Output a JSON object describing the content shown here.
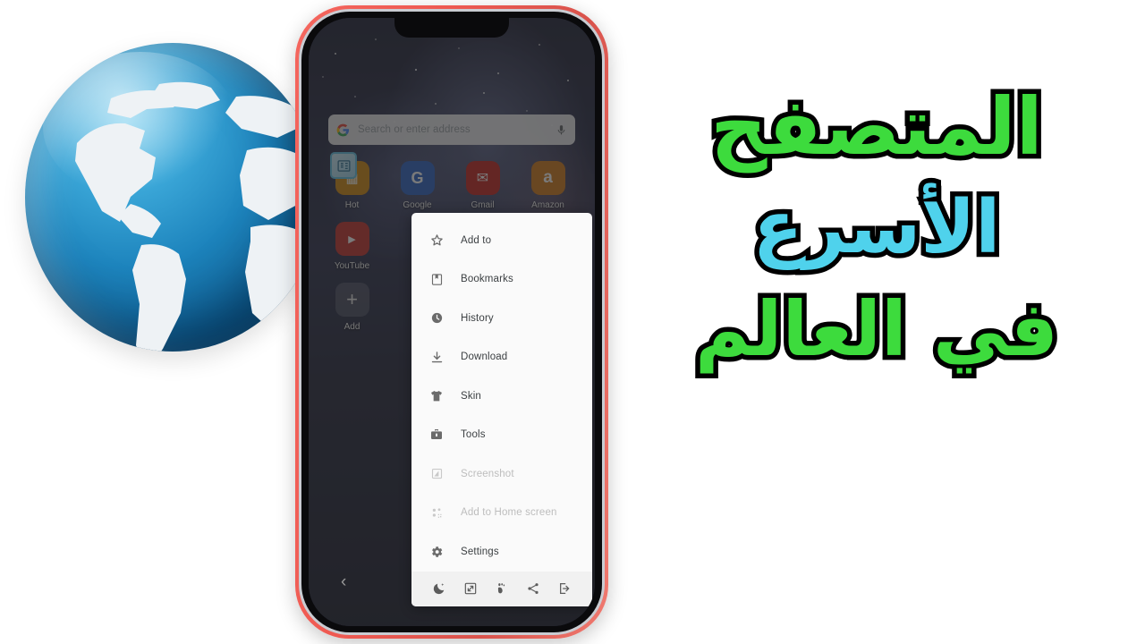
{
  "headline": {
    "line1": "المتصفح",
    "line2": "الأسرع",
    "line3": "في العالم",
    "color_green": "#3ddb3d",
    "color_cyan": "#4fd2ec",
    "outline_color": "#000000"
  },
  "phone": {
    "frame_color": "#ef5a52",
    "back_label": "‹"
  },
  "browser": {
    "omnibox": {
      "placeholder": "Search or enter address",
      "search_engine_icon": "google-g-icon",
      "mic_icon": "microphone-icon"
    },
    "shortcuts": [
      {
        "label": "Hot",
        "icon": "hot-icon",
        "color": "#d1880f",
        "glyph": "▦"
      },
      {
        "label": "Google",
        "icon": "google-icon",
        "color": "#2b63c4",
        "glyph": "G"
      },
      {
        "label": "Gmail",
        "icon": "gmail-icon",
        "color": "#c5221f",
        "glyph": "✉"
      },
      {
        "label": "Amazon",
        "icon": "amazon-icon",
        "color": "#d3791a",
        "glyph": "a"
      },
      {
        "label": "YouTube",
        "icon": "youtube-icon",
        "color": "#c4302b",
        "glyph": "▶"
      },
      {
        "label": "Add",
        "icon": "plus-icon",
        "color": "transparent",
        "glyph": "+"
      }
    ],
    "news_badge_icon": "news-article-icon"
  },
  "menu": {
    "items": [
      {
        "label": "Add to",
        "icon": "star-icon",
        "disabled": false
      },
      {
        "label": "Bookmarks",
        "icon": "bookmark-icon",
        "disabled": false
      },
      {
        "label": "History",
        "icon": "clock-icon",
        "disabled": false
      },
      {
        "label": "Download",
        "icon": "download-icon",
        "disabled": false
      },
      {
        "label": "Skin",
        "icon": "tshirt-icon",
        "disabled": false
      },
      {
        "label": "Tools",
        "icon": "toolbox-icon",
        "disabled": false
      },
      {
        "label": "Screenshot",
        "icon": "screenshot-icon",
        "disabled": true
      },
      {
        "label": "Add to Home screen",
        "icon": "home-screen-icon",
        "disabled": true
      },
      {
        "label": "Settings",
        "icon": "gear-icon",
        "disabled": false
      }
    ],
    "toolbar": [
      {
        "name": "night-mode-icon"
      },
      {
        "name": "fullscreen-icon"
      },
      {
        "name": "incognito-footprint-icon"
      },
      {
        "name": "share-icon"
      },
      {
        "name": "exit-icon"
      }
    ]
  }
}
